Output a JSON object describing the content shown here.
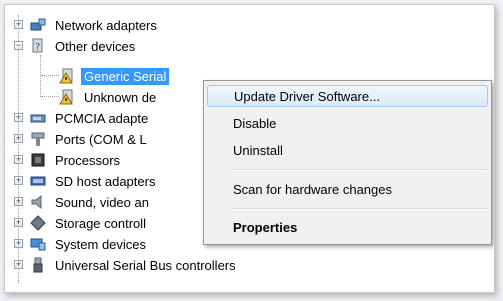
{
  "tree": {
    "items": [
      {
        "label": "Network adapters",
        "icon": "network-adapter-icon",
        "expanded": false
      },
      {
        "label": "Other devices",
        "icon": "unknown-device-icon",
        "expanded": true
      },
      {
        "label": "Generic Serial",
        "icon": "warning-device-icon",
        "selected": true
      },
      {
        "label": "Unknown de",
        "icon": "warning-device-icon"
      },
      {
        "label": "PCMCIA adapte",
        "icon": "pcmcia-icon",
        "expanded": false
      },
      {
        "label": "Ports (COM & L",
        "icon": "port-icon",
        "expanded": false
      },
      {
        "label": "Processors",
        "icon": "processor-icon",
        "expanded": false
      },
      {
        "label": "SD host adapters",
        "icon": "sd-card-icon",
        "expanded": false
      },
      {
        "label": "Sound, video an",
        "icon": "speaker-icon",
        "expanded": false
      },
      {
        "label": "Storage controll",
        "icon": "storage-icon",
        "expanded": false
      },
      {
        "label": "System devices",
        "icon": "system-device-icon",
        "expanded": false
      },
      {
        "label": "Universal Serial Bus controllers",
        "icon": "usb-icon",
        "expanded": false
      }
    ]
  },
  "context_menu": {
    "items": [
      {
        "label": "Update Driver Software...",
        "highlighted": true
      },
      {
        "label": "Disable"
      },
      {
        "label": "Uninstall"
      },
      {
        "label": "Scan for hardware changes"
      },
      {
        "label": "Properties",
        "bold": true
      }
    ]
  },
  "colors": {
    "selection": "#3399ff",
    "menu_background": "#f0f0f0",
    "menu_highlight_border": "#a8c8ef"
  }
}
